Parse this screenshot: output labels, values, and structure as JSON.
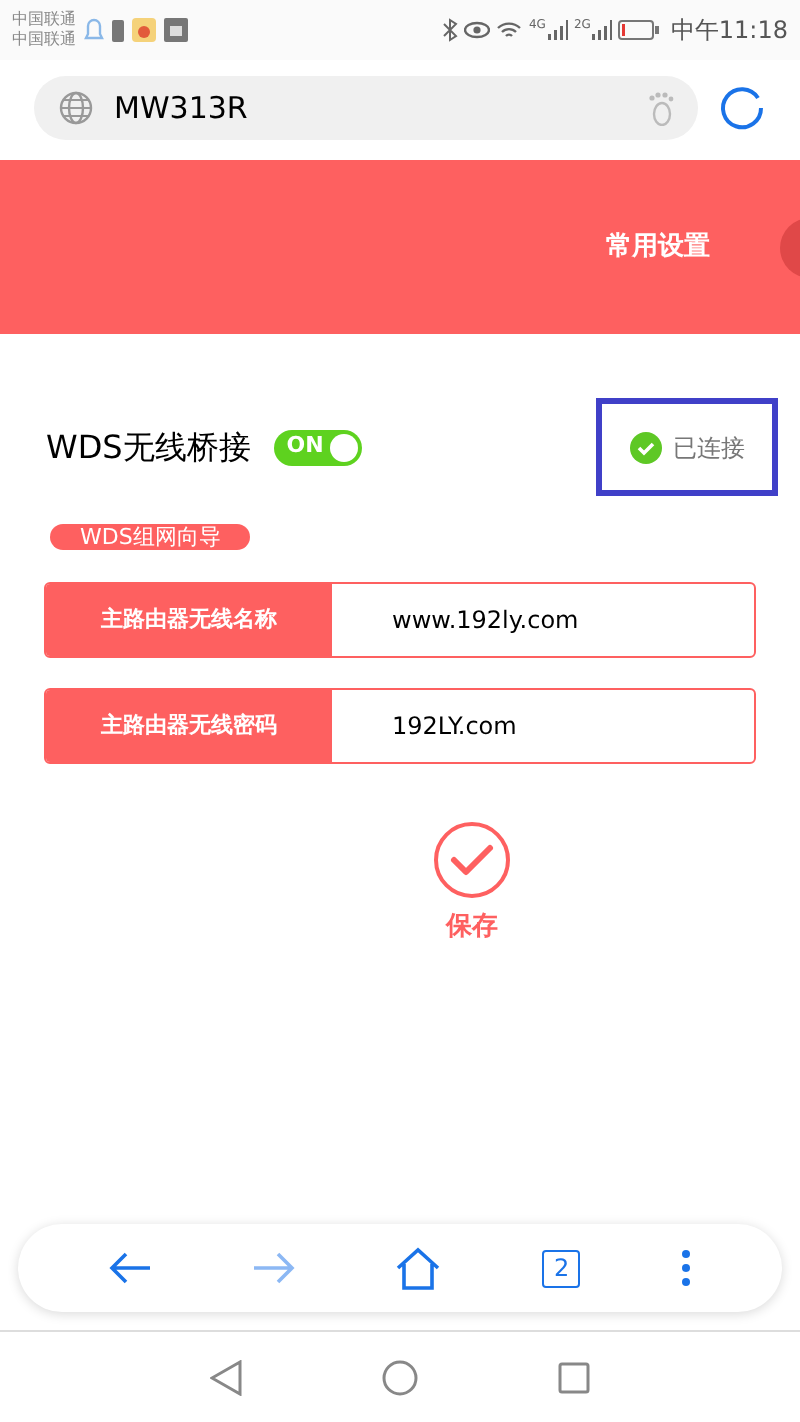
{
  "status_bar": {
    "carriers": [
      "中国联通",
      "中国联通"
    ],
    "network_labels": [
      "4G",
      "2G"
    ],
    "time": "中午11:18"
  },
  "browser": {
    "url": "MW313R",
    "tab_count": "2"
  },
  "header": {
    "menu_item": "常用设置"
  },
  "wds": {
    "label": "WDS无线桥接",
    "toggle": {
      "label": "ON",
      "on": true
    },
    "status": {
      "text": "已连接",
      "connected": true,
      "highlighted": true
    }
  },
  "guide_badge": "WDS组网向导",
  "fields": [
    {
      "label": "主路由器无线名称",
      "value": "www.192ly.com"
    },
    {
      "label": "主路由器无线密码",
      "value": "192LY.com"
    }
  ],
  "save": {
    "label": "保存"
  }
}
